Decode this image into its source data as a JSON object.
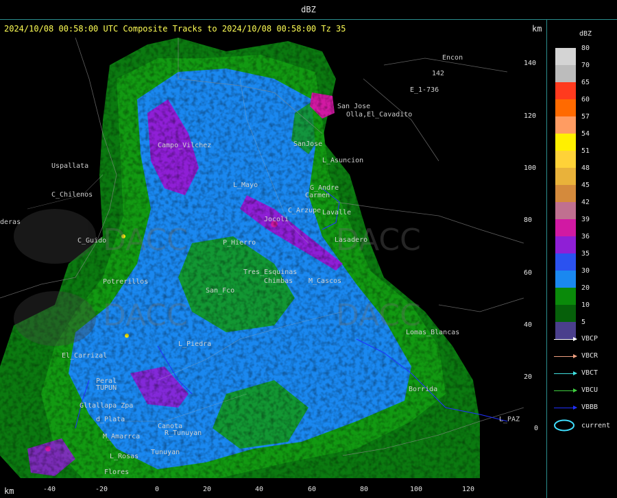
{
  "window": {
    "title": "dBZ"
  },
  "header": {
    "subtitle": "2024/10/08 00:58:00 UTC Composite Tracks to 2024/10/08 00:58:00 Tz 35",
    "km_top": "km",
    "km_bottom": "km"
  },
  "axes": {
    "y_ticks": [
      "140",
      "120",
      "100",
      "80",
      "60",
      "40",
      "20",
      "0"
    ],
    "x_ticks": [
      "-40",
      "-20",
      "0",
      "20",
      "40",
      "60",
      "80",
      "100",
      "120"
    ]
  },
  "legend": {
    "title": "dBZ",
    "levels": [
      {
        "label": "80",
        "color": "#d4d4d4"
      },
      {
        "label": "70",
        "color": "#bcbcbc"
      },
      {
        "label": "65",
        "color": "#ff3a1e"
      },
      {
        "label": "60",
        "color": "#ff6a00"
      },
      {
        "label": "57",
        "color": "#ff9c62"
      },
      {
        "label": "54",
        "color": "#fff000"
      },
      {
        "label": "51",
        "color": "#ffd238"
      },
      {
        "label": "48",
        "color": "#e9b23a"
      },
      {
        "label": "45",
        "color": "#d48a3c"
      },
      {
        "label": "42",
        "color": "#c07090"
      },
      {
        "label": "39",
        "color": "#d119a3"
      },
      {
        "label": "36",
        "color": "#8f1fd6"
      },
      {
        "label": "35",
        "color": "#2b52f0"
      },
      {
        "label": "30",
        "color": "#1a88f0"
      },
      {
        "label": "20",
        "color": "#0a8a0a"
      },
      {
        "label": "10",
        "color": "#06600a"
      },
      {
        "label": "5",
        "color": "#4a3f8c"
      }
    ],
    "tracks": [
      {
        "label": "VBCP",
        "color": "#ffffff"
      },
      {
        "label": "VBCR",
        "color": "#f0a080"
      },
      {
        "label": "VBCT",
        "color": "#40e0e0"
      },
      {
        "label": "VBCU",
        "color": "#40d040"
      },
      {
        "label": "VBBB",
        "color": "#2030ff"
      }
    ],
    "current": {
      "label": "current",
      "color": "#40e0ff"
    }
  },
  "places": [
    "Encon",
    "E_1-736",
    "142",
    "San Jose",
    "Olla,El_Cavadito",
    "SanJose",
    "L_Asuncion",
    "Uspallata",
    "C_Chilenos",
    "deras",
    "C_Guido",
    "Potrerillos",
    "G_Andre",
    "Carmen",
    "C_Arzupe",
    "Lavalle",
    "Lasadero",
    "L_Mayo",
    "P_Hierro",
    "Chimbas",
    "M_Cascos",
    "Lomas_Blancas",
    "Borrida",
    "L_PAZ",
    "Gltallapa_Zpa",
    "d_Plata",
    "TUPUN",
    "Peral",
    "Flores",
    "L_Rosas",
    "Tunuyan",
    "Jocoli",
    "Tres_Esquinas",
    "M_Amarrca",
    "L_Piedra",
    "San_Fco",
    "R_Tunuyan",
    "Canota",
    "El_Carrizal",
    "Campo_Vilchez"
  ]
}
